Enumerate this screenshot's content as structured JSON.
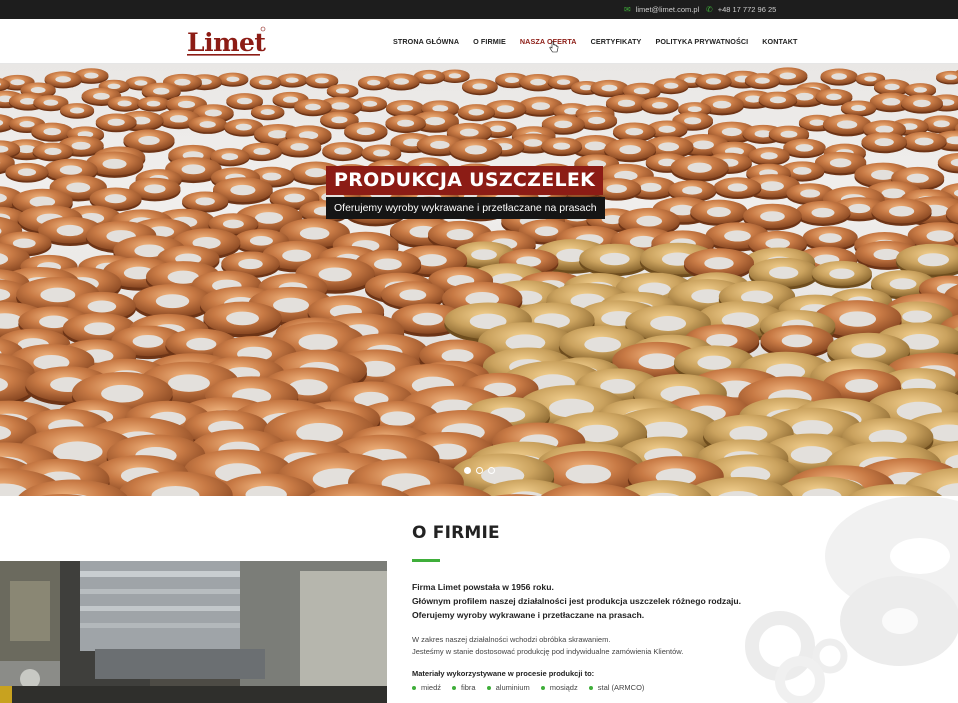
{
  "topbar": {
    "email": "limet@limet.com.pl",
    "email_icon": "envelope-icon",
    "phone": "+48 17 772 96 25",
    "phone_icon": "phone-icon"
  },
  "header": {
    "logo_text": "Limet",
    "nav": [
      {
        "label": "STRONA GŁÓWNA"
      },
      {
        "label": "O FIRMIE"
      },
      {
        "label": "NASZA OFERTA",
        "active": true
      },
      {
        "label": "CERTYFIKATY"
      },
      {
        "label": "POLITYKA PRYWATNOŚCI"
      },
      {
        "label": "KONTAKT"
      }
    ]
  },
  "hero": {
    "title": "PRODUKCJA USZCZELEK",
    "subtitle": "Oferujemy wyroby wykrawane i przetłaczane na prasach",
    "slides": 3,
    "active_slide": 1
  },
  "about": {
    "heading": "O FIRMIE",
    "lead": [
      "Firma Limet powstała w 1956 roku.",
      "Głównym profilem naszej działalności jest produkcja uszczelek różnego rodzaju.",
      "Oferujemy wyroby wykrawane i przetłaczane na prasach."
    ],
    "body": [
      "W zakres naszej działalności wchodzi obróbka skrawaniem.",
      "Jesteśmy w stanie dostosować produkcję pod indywidualne zamówienia Klientów."
    ],
    "materials_title": "Materiały wykorzystywane w procesie produkcji to:",
    "materials": [
      "miedź",
      "fibra",
      "aluminium",
      "mosiądz",
      "stal (ARMCO)"
    ]
  },
  "colors": {
    "brand_red": "#8c1c15",
    "accent_green": "#3fae3a",
    "topbar_bg": "#1d1d1d"
  }
}
